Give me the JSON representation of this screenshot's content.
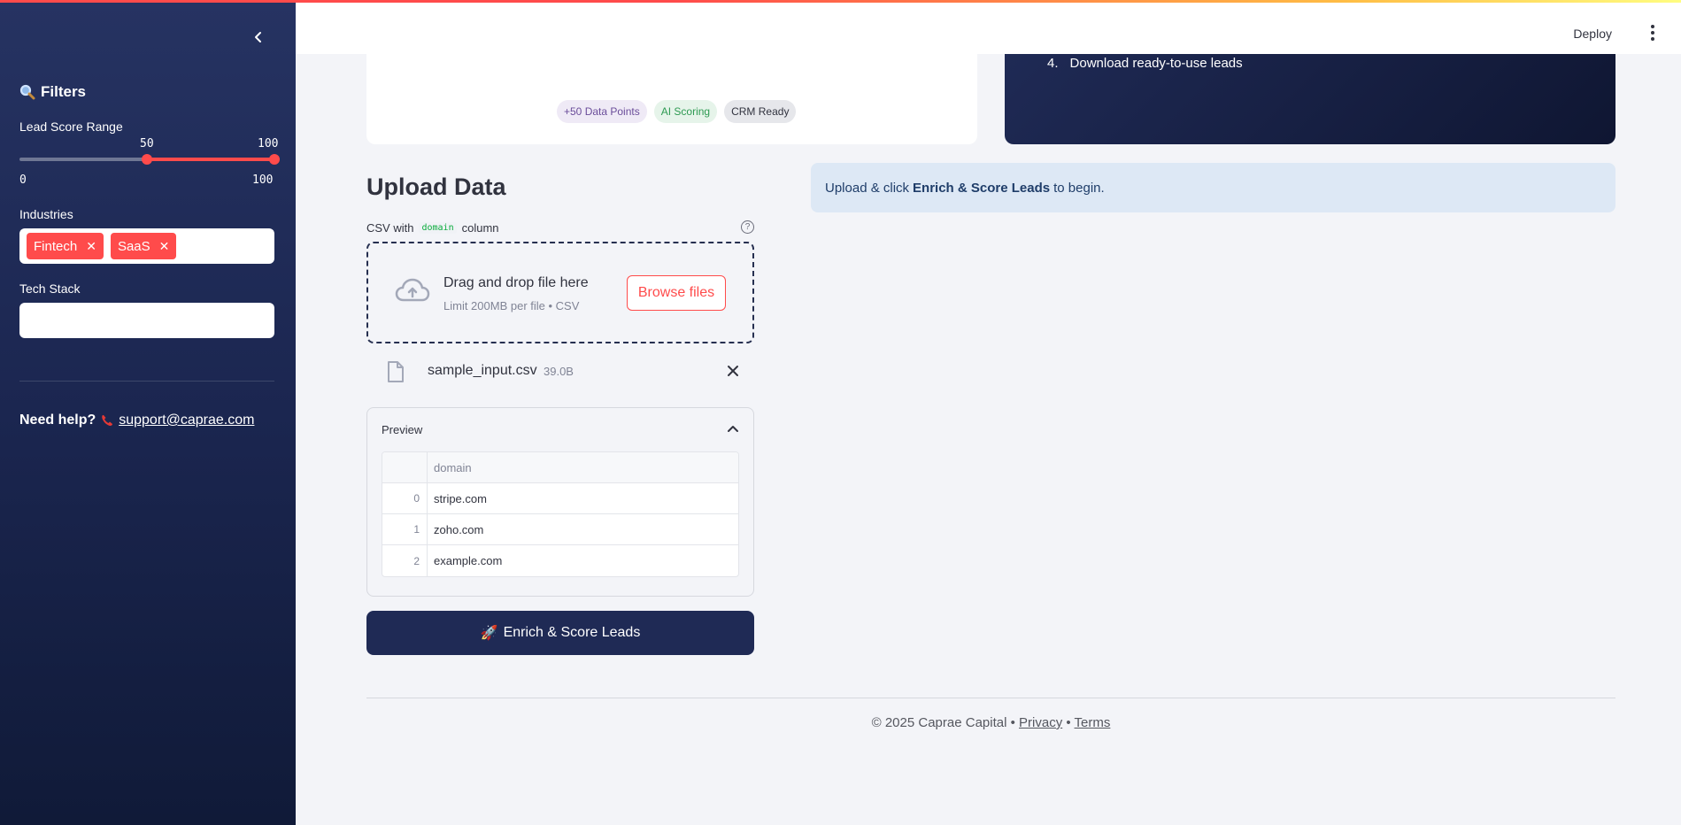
{
  "sidebar": {
    "title": "Filters",
    "slider": {
      "label": "Lead Score Range",
      "low": 50,
      "high": 100,
      "min": 0,
      "max": 100,
      "low_text": "50",
      "high_text": "100",
      "min_text": "0",
      "max_text": "100"
    },
    "industries": {
      "label": "Industries",
      "tags": [
        "Fintech",
        "SaaS"
      ]
    },
    "tech_stack": {
      "label": "Tech Stack",
      "value": ""
    },
    "help": {
      "text": "Need help?",
      "email": "support@caprae.com"
    }
  },
  "header": {
    "deploy_label": "Deploy"
  },
  "top_cards": {
    "pills": [
      "+50 Data Points",
      "AI Scoring",
      "CRM Ready"
    ],
    "step": {
      "number": "4.",
      "text": "Download ready-to-use leads"
    }
  },
  "upload": {
    "title": "Upload Data",
    "label_prefix": "CSV with",
    "label_code": "domain",
    "label_suffix": "column",
    "help_glyph": "?",
    "dropzone_main": "Drag and drop file here",
    "dropzone_sub": "Limit 200MB per file • CSV",
    "browse_label": "Browse files",
    "file": {
      "name": "sample_input.csv",
      "size": "39.0B"
    }
  },
  "preview": {
    "title": "Preview",
    "column": "domain",
    "rows": [
      {
        "index": "0",
        "domain": "stripe.com"
      },
      {
        "index": "1",
        "domain": "zoho.com"
      },
      {
        "index": "2",
        "domain": "example.com"
      }
    ]
  },
  "enrich_button": {
    "icon": "🚀",
    "label": "Enrich & Score Leads"
  },
  "info": {
    "prefix": "Upload & click",
    "bold": "Enrich & Score Leads",
    "suffix": "to begin."
  },
  "footer": {
    "copyright": "© 2025 Caprae Capital •",
    "privacy": "Privacy",
    "sep": "•",
    "terms": "Terms"
  },
  "colors": {
    "accent": "#ff4b4b",
    "sidebar_bg": "#1b2650",
    "button_bg": "#1f2a55",
    "info_bg": "#dde8f5"
  }
}
